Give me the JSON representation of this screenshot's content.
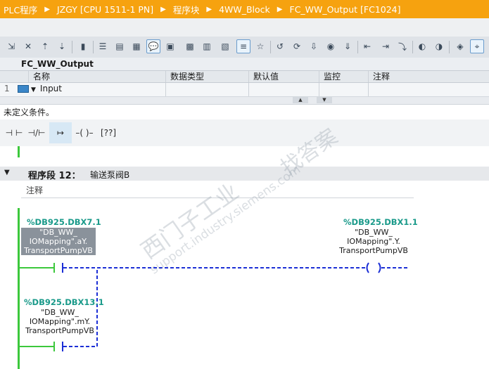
{
  "breadcrumb": {
    "items": [
      "PLC程序",
      "JZGY [CPU 1511-1 PN]",
      "程序块",
      "4WW_Block",
      "FC_WW_Output [FC1024]"
    ],
    "separator": "▸"
  },
  "toolbar": {
    "icons": [
      "insert-network-icon",
      "delete-network-icon",
      "insert-row-icon",
      "add-row-icon",
      "network-ops-icon",
      "wrap-icon",
      "show-absolute-icon",
      "show-list-icon",
      "comments-icon",
      "show-tags-icon",
      "show-symbol-icon",
      "tag-info-icon",
      "network-comments-icon",
      "favorites-icon",
      "goto-icon",
      "monitor-icon",
      "snapshot-icon",
      "download-icon",
      "breakpoint-icon",
      "step-icon",
      "step-over-icon",
      "call-env-icon",
      "monitor-on-icon",
      "modify-icon",
      "overview-icon",
      "glasses-icon"
    ]
  },
  "block": {
    "title": "FC_WW_Output"
  },
  "interface": {
    "columns": [
      "名称",
      "数据类型",
      "默认值",
      "监控",
      "注释"
    ],
    "rows": [
      {
        "index": "1",
        "name": "Input"
      }
    ]
  },
  "condition_text": "未定义条件。",
  "palette": {
    "items": [
      {
        "name": "no-contact",
        "glyph": "⊣ ⊢"
      },
      {
        "name": "nc-contact",
        "glyph": "⊣/⊢"
      },
      {
        "name": "branch",
        "glyph": "↦"
      },
      {
        "name": "coil",
        "glyph": "–( )–"
      },
      {
        "name": "empty-box",
        "glyph": "[??]"
      }
    ]
  },
  "network": {
    "label": "程序段 12：",
    "title": "输送泵阀B",
    "comment": "注释",
    "contact1": {
      "address": "%DB925.DBX7.1",
      "tag": [
        "\"DB_WW_",
        "IOMapping\".aY.",
        "TransportPumpVB"
      ]
    },
    "contact2": {
      "address": "%DB925.DBX13.1",
      "tag": [
        "\"DB_WW_",
        "IOMapping\".mY.",
        "TransportPumpVB"
      ]
    },
    "coil": {
      "address": "%DB925.DBX1.1",
      "tag": [
        "\"DB_WW_",
        "IOMapping\".Y.",
        "TransportPumpVB"
      ]
    }
  },
  "watermark": {
    "line1": "西门子工业",
    "line2": "support.industry.siemens.com",
    "line3": "找答案"
  },
  "colors": {
    "accent": "#f6a20f",
    "address": "#1a9a8a",
    "rail": "#3cc83c",
    "wire": "#1c2fd6"
  }
}
